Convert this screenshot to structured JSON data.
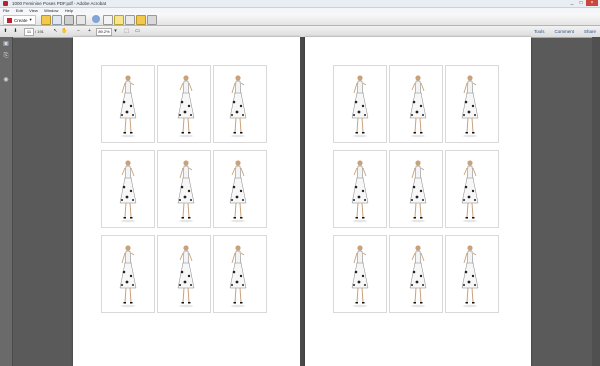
{
  "window": {
    "title": "1000 Feminine Poses PDF.pdf - Adobe Acrobat",
    "buttons": [
      "_",
      "□",
      "×"
    ]
  },
  "menu": [
    "File",
    "Edit",
    "View",
    "Window",
    "Help"
  ],
  "toolbar": {
    "create_label": "Create"
  },
  "navigation": {
    "page_current": "11",
    "page_total": "/ 191",
    "zoom": "89.2%"
  },
  "panels": [
    "Tools",
    "Comment",
    "Share"
  ],
  "sidebar_icons": [
    "pages-icon",
    "attachment-icon",
    "bookmark-icon"
  ],
  "pages": [
    {
      "name": "left",
      "thumbnails": 9
    },
    {
      "name": "right",
      "thumbnails": 9
    }
  ],
  "colors": {
    "titlebar": "#e9eef5",
    "workspace": "#5a5a5a",
    "accent_red": "#c0202a",
    "panel_link": "#2a4f8a"
  }
}
